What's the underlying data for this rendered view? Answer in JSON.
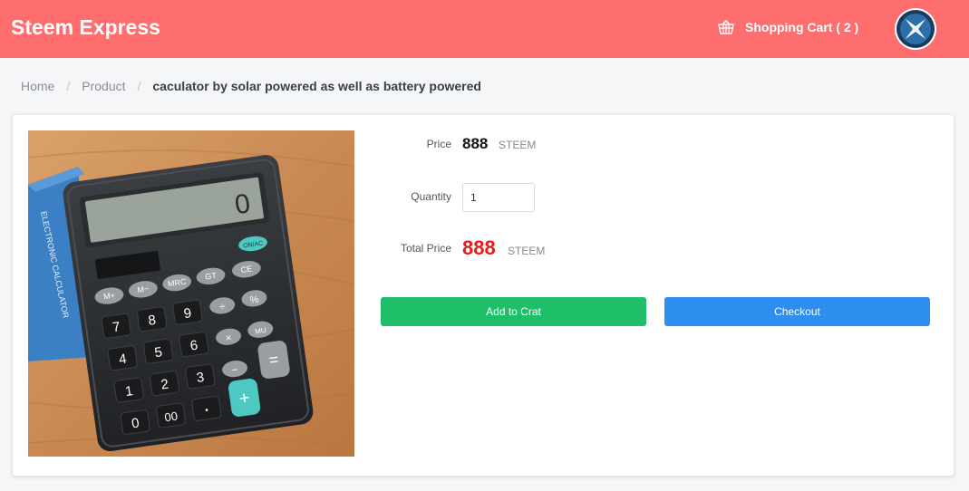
{
  "header": {
    "brand": "Steem Express",
    "cart_label": "Shopping Cart ( 2 )"
  },
  "breadcrumb": {
    "home": "Home",
    "product": "Product",
    "current": "caculator by solar powered as well as battery powered"
  },
  "product": {
    "price_label": "Price",
    "price_value": "888",
    "price_unit": "STEEM",
    "quantity_label": "Quantity",
    "quantity_value": "1",
    "total_label": "Total Price",
    "total_value": "888",
    "total_unit": "STEEM"
  },
  "actions": {
    "add_label": "Add to Crat",
    "checkout_label": "Checkout"
  },
  "image": {
    "box_brand": "ELECTRONIC CALCULATOR",
    "display_digit": "0",
    "key_on": "ON/AC",
    "key_ce": "CE",
    "key_gt": "GT",
    "key_mrc": "MRC",
    "key_mminus": "M−",
    "key_mplus": "M+",
    "key_mu": "MU",
    "key_pct": "%",
    "key_div": "÷",
    "key_mul": "×",
    "key_minus": "−",
    "key_plus": "+",
    "key_eq": "=",
    "key_dot": "•",
    "key_00": "00",
    "key_0": "0",
    "key_1": "1",
    "key_2": "2",
    "key_3": "3",
    "key_4": "4",
    "key_5": "5",
    "key_6": "6",
    "key_7": "7",
    "key_8": "8",
    "key_9": "9"
  },
  "colors": {
    "header": "#ff6e6e",
    "add_button": "#1fbf6a",
    "checkout_button": "#2e8ef0",
    "total_price": "#e81a1a"
  }
}
